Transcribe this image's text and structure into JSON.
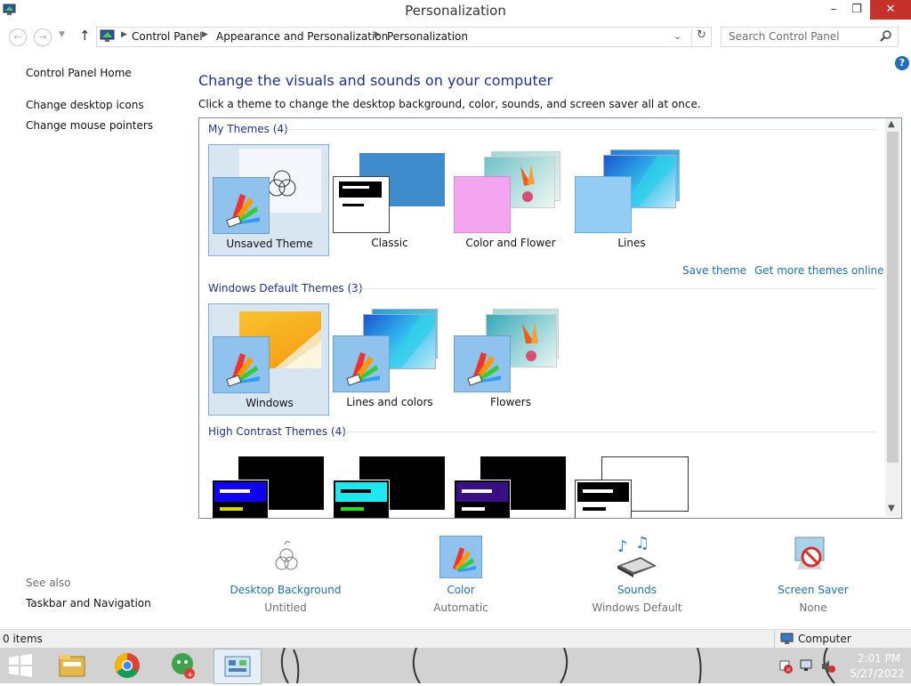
{
  "window": {
    "title": "Personalization",
    "minimize_glyph": "–",
    "maximize_glyph": "❐",
    "close_glyph": "✕"
  },
  "address": {
    "crumbs": [
      "Control Panel",
      "Appearance and Personalization",
      "Personalization"
    ],
    "search_placeholder": "Search Control Panel"
  },
  "sidebar": {
    "home": "Control Panel Home",
    "links": [
      "Change desktop icons",
      "Change mouse pointers"
    ],
    "see_also_header": "See also",
    "see_also_links": [
      "Taskbar and Navigation"
    ]
  },
  "main": {
    "heading": "Change the visuals and sounds on your computer",
    "subtext": "Click a theme to change the desktop background, color, sounds, and screen saver all at once.",
    "groups": {
      "my": {
        "header": "My Themes (4)",
        "themes": [
          "Unsaved Theme",
          "Classic",
          "Color and Flower",
          "Lines"
        ]
      },
      "default": {
        "header": "Windows Default Themes (3)",
        "themes": [
          "Windows",
          "Lines and colors",
          "Flowers"
        ]
      },
      "contrast": {
        "header": "High Contrast Themes (4)"
      }
    },
    "save_theme": "Save theme",
    "get_more": "Get more themes online"
  },
  "bottom": {
    "items": [
      {
        "label": "Desktop Background",
        "value": "Untitled"
      },
      {
        "label": "Color",
        "value": "Automatic"
      },
      {
        "label": "Sounds",
        "value": "Windows Default"
      },
      {
        "label": "Screen Saver",
        "value": "None"
      }
    ]
  },
  "status": {
    "items": "0 items",
    "location": "Computer"
  },
  "taskbar": {
    "time": "2:01 PM",
    "date": "5/27/2022"
  },
  "colors": {
    "accent": "#1e3287",
    "link": "#1e6fb5",
    "selection": "#d8e6f2",
    "close": "#c7312b"
  }
}
